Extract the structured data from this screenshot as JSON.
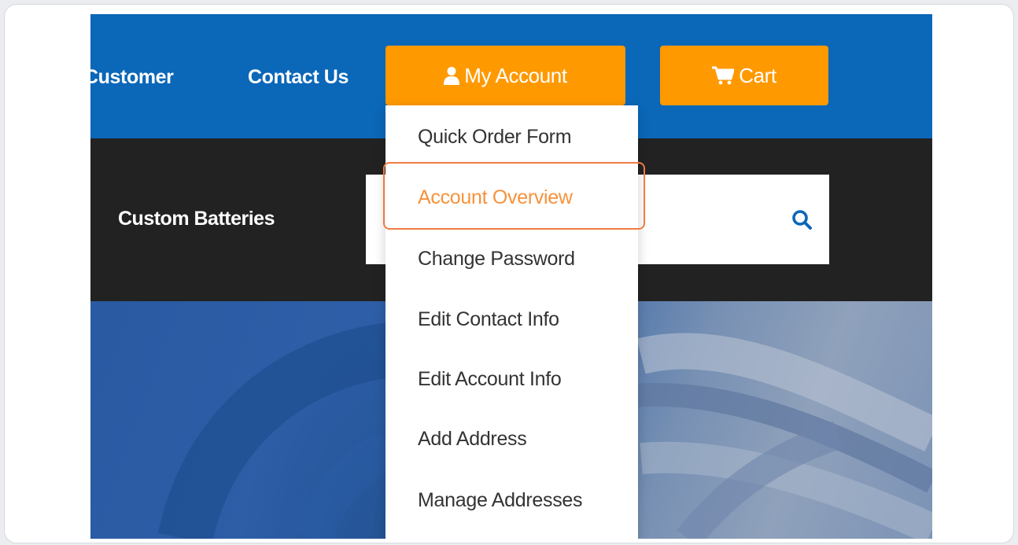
{
  "nav": {
    "customer_label": "Customer",
    "contact_label": "Contact Us",
    "account_label": "My Account",
    "cart_label": "Cart"
  },
  "search": {
    "category_label": "Custom Batteries",
    "value": "",
    "placeholder": ""
  },
  "account_menu": {
    "items": [
      "Quick Order Form",
      "Account Overview",
      "Change Password",
      "Edit Contact Info",
      "Edit Account Info",
      "Add Address",
      "Manage Addresses"
    ],
    "highlighted_item": "Account Overview"
  },
  "icons": {
    "account": "user-icon",
    "cart": "cart-icon",
    "search": "search-icon"
  },
  "colors": {
    "nav_blue": "#0b67b8",
    "accent_orange": "#ff9900",
    "dark_band": "#222222",
    "highlight": "#f27a45",
    "search_icon": "#0b67b8"
  }
}
